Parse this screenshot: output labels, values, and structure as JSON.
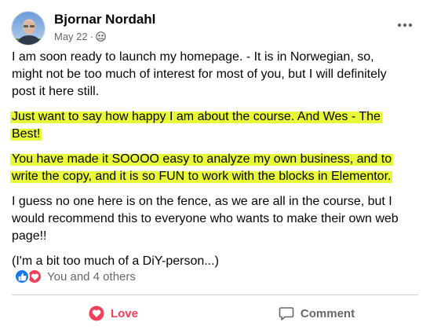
{
  "post": {
    "author": "Bjornar Nordahl",
    "date": "May 22",
    "separator": "·",
    "privacy_icon": "friends-icon",
    "more_icon": "more-options-icon",
    "paragraphs": [
      "I am soon ready to launch my homepage. - It is in Norwegian, so, might not be too much of interest for most of you, but I will definitely post it here still.",
      "Just want to say how happy I am about the course. And Wes - The Best!",
      "You have made it SOOOO easy to analyze my own business, and to write the copy, and it is so FUN to work with the blocks in Elementor.",
      "I guess no one here is on the fence, as we are all in the course, but I would recommend this to everyone who wants to make their own web page!!",
      "(I'm a bit too much of a DiY-person...)"
    ],
    "highlight_color": "#e9f93a"
  },
  "reactions": {
    "icons": [
      "like-icon",
      "love-icon"
    ],
    "summary": "You and 4 others"
  },
  "actions": {
    "love_label": "Love",
    "comment_label": "Comment"
  },
  "colors": {
    "like": "#1877f2",
    "love": "#f33e58",
    "secondary_text": "#65676b"
  }
}
